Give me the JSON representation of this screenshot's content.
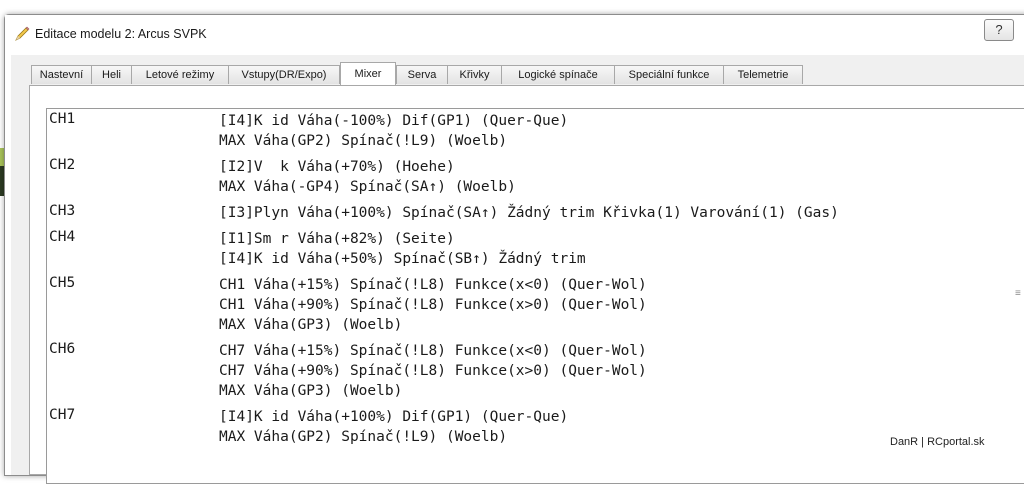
{
  "window": {
    "title": "Editace modelu 2: Arcus SVPK",
    "help_label": "?"
  },
  "tabs": [
    {
      "label": "Nastevní"
    },
    {
      "label": "Heli"
    },
    {
      "label": "Letové režimy"
    },
    {
      "label": "Vstupy(DR/Expo)"
    },
    {
      "label": "Mixer"
    },
    {
      "label": "Serva"
    },
    {
      "label": "Křivky"
    },
    {
      "label": "Logické spínače"
    },
    {
      "label": "Speciální funkce"
    },
    {
      "label": "Telemetrie"
    }
  ],
  "active_tab": "Mixer",
  "channels": [
    {
      "name": "CH1",
      "lines": [
        "[I4]K id Váha(-100%) Dif(GP1) (Quer-Que)",
        "MAX Váha(GP2) Spínač(!L9) (Woelb)"
      ]
    },
    {
      "name": "CH2",
      "lines": [
        "[I2]V  k Váha(+70%) (Hoehe)",
        "MAX Váha(-GP4) Spínač(SA↑) (Woelb)"
      ]
    },
    {
      "name": "CH3",
      "lines": [
        "[I3]Plyn Váha(+100%) Spínač(SA↑) Žádný trim Křivka(1) Varování(1) (Gas)"
      ]
    },
    {
      "name": "CH4",
      "lines": [
        "[I1]Sm r Váha(+82%) (Seite)",
        "[I4]K id Váha(+50%) Spínač(SB↑) Žádný trim"
      ]
    },
    {
      "name": "CH5",
      "lines": [
        "CH1 Váha(+15%) Spínač(!L8) Funkce(x<0) (Quer-Wol)",
        "CH1 Váha(+90%) Spínač(!L8) Funkce(x>0) (Quer-Wol)",
        "MAX Váha(GP3) (Woelb)"
      ]
    },
    {
      "name": "CH6",
      "lines": [
        "CH7 Váha(+15%) Spínač(!L8) Funkce(x<0) (Quer-Wol)",
        "CH7 Váha(+90%) Spínač(!L8) Funkce(x>0) (Quer-Wol)",
        "MAX Váha(GP3) (Woelb)"
      ]
    },
    {
      "name": "CH7",
      "lines": [
        "[I4]K id Váha(+100%) Dif(GP1) (Quer-Que)",
        "MAX Váha(GP2) Spínač(!L9) (Woelb)"
      ]
    }
  ],
  "footer": "DanR | RCportal.sk",
  "colors": {
    "tab_bg": "#e8e8e8",
    "client_bg": "#f0f0f0",
    "text": "#1a1a1a"
  },
  "icons": {
    "title": "pencil-icon",
    "scroll": "scroll-grip-icon"
  }
}
